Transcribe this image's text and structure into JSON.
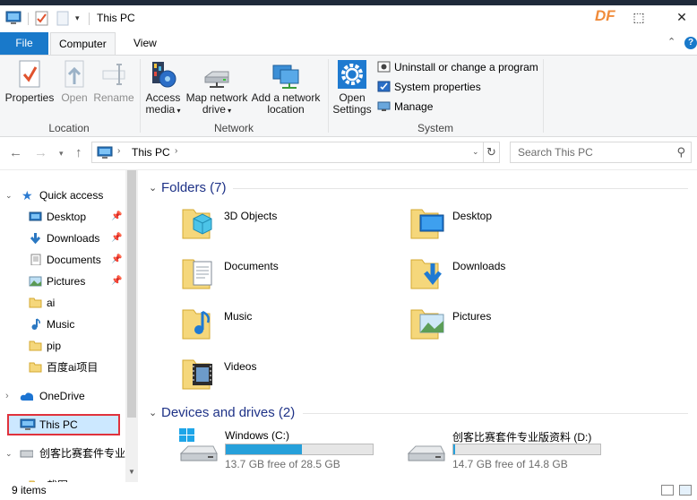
{
  "window": {
    "title": "This PC",
    "brand_logo": "DF"
  },
  "titlebar": {
    "minimize_label": "—",
    "restore_label": "⬚",
    "close_label": "✕"
  },
  "ribbon_tabs": {
    "file": "File",
    "computer": "Computer",
    "view": "View",
    "help": "?"
  },
  "ribbon": {
    "location": {
      "label": "Location",
      "properties": "Properties",
      "open": "Open",
      "rename": "Rename"
    },
    "network": {
      "label": "Network",
      "access_media_line1": "Access",
      "access_media_line2": "media",
      "map_drive_line1": "Map network",
      "map_drive_line2": "drive",
      "add_location_line1": "Add a network",
      "add_location_line2": "location"
    },
    "system": {
      "label": "System",
      "open_settings_line1": "Open",
      "open_settings_line2": "Settings",
      "uninstall": "Uninstall or change a program",
      "system_properties": "System properties",
      "manage": "Manage"
    }
  },
  "addressbar": {
    "path": "This PC",
    "search_placeholder": "Search This PC"
  },
  "navpane": {
    "quick_access": "Quick access",
    "items": [
      {
        "label": "Desktop",
        "icon": "desktop-icon",
        "pinned": true
      },
      {
        "label": "Downloads",
        "icon": "download-arrow-icon",
        "pinned": true
      },
      {
        "label": "Documents",
        "icon": "document-icon",
        "pinned": true
      },
      {
        "label": "Pictures",
        "icon": "pictures-icon",
        "pinned": true
      },
      {
        "label": "ai",
        "icon": "folder-icon",
        "pinned": false
      },
      {
        "label": "Music",
        "icon": "music-note-icon",
        "pinned": false
      },
      {
        "label": "pip",
        "icon": "folder-icon",
        "pinned": false
      },
      {
        "label": "百度ai项目",
        "icon": "folder-icon",
        "pinned": false
      }
    ],
    "onedrive": "OneDrive",
    "this_pc": "This PC",
    "drive": "创客比赛套件专业",
    "sub": "截图"
  },
  "content": {
    "folders_header": "Folders (7)",
    "folders": [
      {
        "label": "3D Objects",
        "icon": "3d-objects-folder-icon"
      },
      {
        "label": "Desktop",
        "icon": "desktop-folder-icon"
      },
      {
        "label": "Documents",
        "icon": "documents-folder-icon"
      },
      {
        "label": "Downloads",
        "icon": "downloads-folder-icon"
      },
      {
        "label": "Music",
        "icon": "music-folder-icon"
      },
      {
        "label": "Pictures",
        "icon": "pictures-folder-icon"
      },
      {
        "label": "Videos",
        "icon": "videos-folder-icon"
      }
    ],
    "devices_header": "Devices and drives (2)",
    "drives": [
      {
        "label": "Windows (C:)",
        "free": "13.7 GB free of 28.5 GB",
        "used_fraction": 0.52
      },
      {
        "label": "创客比赛套件专业版资料 (D:)",
        "free": "14.7 GB free of 14.8 GB",
        "used_fraction": 0.01
      }
    ]
  },
  "statusbar": {
    "count": "9 items"
  },
  "colors": {
    "accent": "#1979ca",
    "selection": "#cce8ff",
    "highlight_box": "#e0323c",
    "header_text": "#1e3287",
    "drive_fill": "#26a0da"
  }
}
